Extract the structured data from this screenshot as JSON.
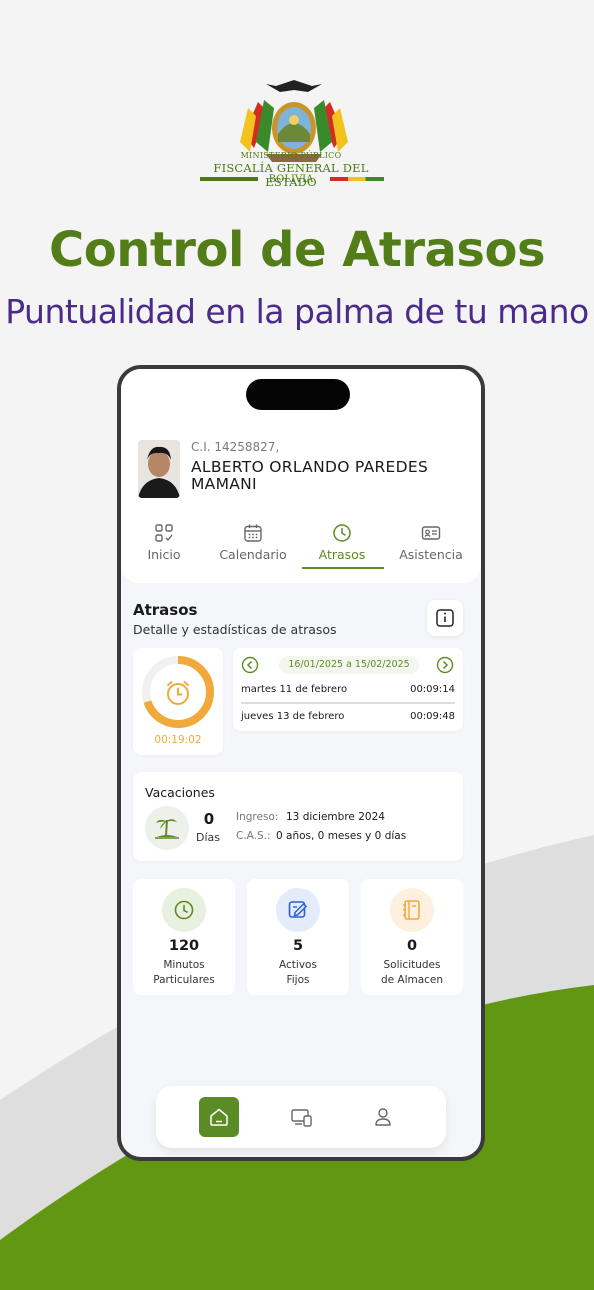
{
  "logo": {
    "line1": "MINISTERIO PÚBLICO",
    "line2": "FISCALÍA GENERAL DEL ESTADO",
    "line3": "BOLIVIA"
  },
  "headline": "Control de Atrasos",
  "tagline": "Puntualidad en la palma de tu mano",
  "colors": {
    "brand_green": "#527d18",
    "tagline_purple": "#4a2b8a",
    "accent_orange": "#f2a93b"
  },
  "app": {
    "user": {
      "ci": "C.I. 14258827,",
      "name": "ALBERTO ORLANDO PAREDES MAMANI"
    },
    "tabs": [
      {
        "label": "Inicio",
        "icon": "dashboard-icon"
      },
      {
        "label": "Calendario",
        "icon": "calendar-icon"
      },
      {
        "label": "Atrasos",
        "icon": "clock-icon",
        "active": true
      },
      {
        "label": "Asistencia",
        "icon": "id-card-icon"
      }
    ],
    "atrasos": {
      "title": "Atrasos",
      "subtitle": "Detalle y estadísticas de atrasos",
      "total_time": "00:19:02",
      "progress": 0.7,
      "range": "16/01/2025 a 15/02/2025",
      "entries": [
        {
          "date": "martes 11 de febrero",
          "time": "00:09:14"
        },
        {
          "date": "jueves 13 de febrero",
          "time": "00:09:48"
        }
      ]
    },
    "vacaciones": {
      "title": "Vacaciones",
      "days": "0",
      "days_label": "Días",
      "ingreso_label": "Ingreso:",
      "ingreso_value": "13 diciembre 2024",
      "cas_label": "C.A.S.:",
      "cas_value": "0 años, 0 meses y 0 días"
    },
    "stats": [
      {
        "value": "120",
        "label1": "Minutos",
        "label2": "Particulares",
        "icon": "clock-icon"
      },
      {
        "value": "5",
        "label1": "Activos",
        "label2": "Fijos",
        "icon": "edit-icon"
      },
      {
        "value": "0",
        "label1": "Solicitudes",
        "label2": "de Almacen",
        "icon": "notebook-icon"
      }
    ],
    "bottom_nav": [
      {
        "icon": "home-icon",
        "active": true
      },
      {
        "icon": "devices-icon"
      },
      {
        "icon": "user-icon"
      }
    ]
  }
}
